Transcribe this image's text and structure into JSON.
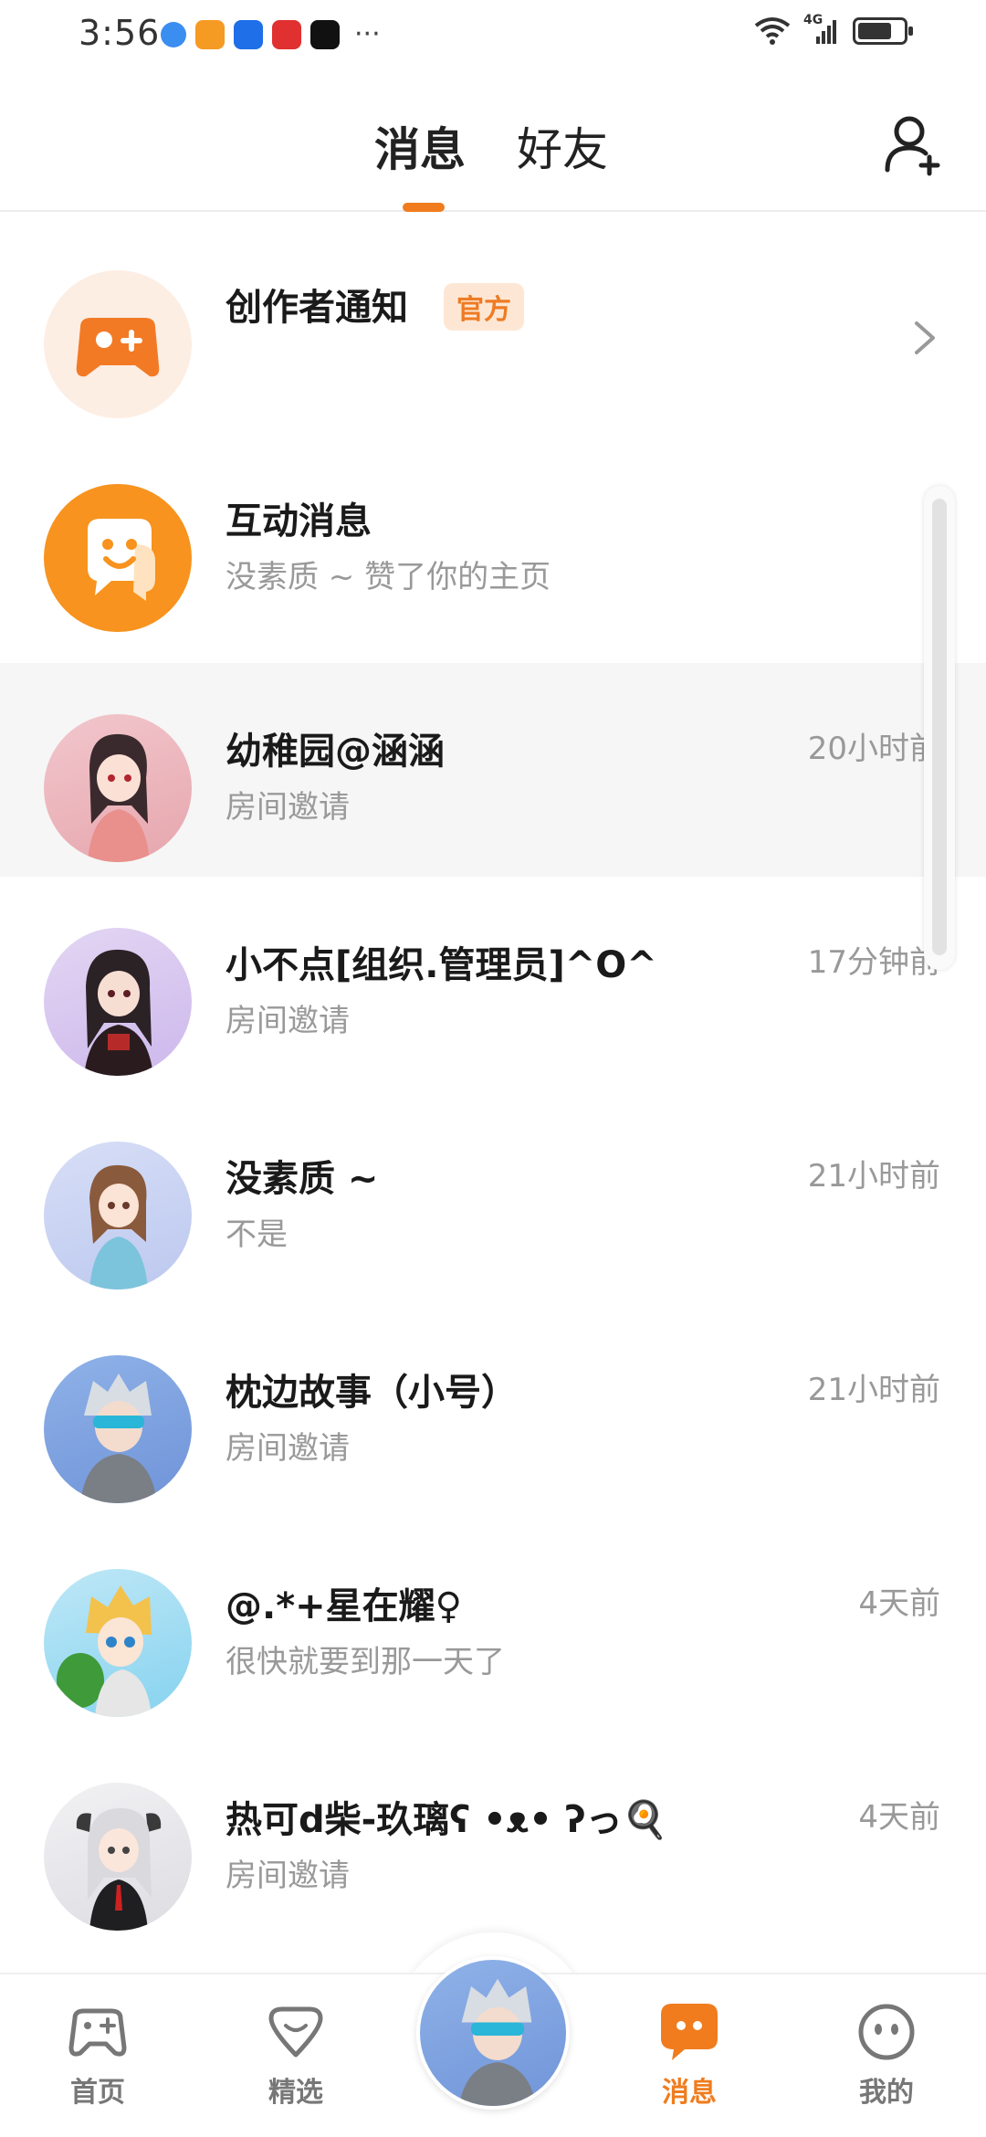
{
  "status_bar": {
    "time": "3:56",
    "more": "···",
    "network": "4G"
  },
  "header": {
    "tabs": [
      {
        "label": "消息",
        "active": true
      },
      {
        "label": "好友",
        "active": false
      }
    ],
    "accent_color": "#f07c1e"
  },
  "list": {
    "rows": [
      {
        "title": "创作者通知",
        "badge": "官方",
        "subtitle": "",
        "time": ""
      },
      {
        "title": "互动消息",
        "subtitle": "没素质 ~ 赞了你的主页",
        "time": ""
      },
      {
        "title": "幼稚园@涵涵",
        "subtitle": "房间邀请",
        "time": "20小时前"
      },
      {
        "title": "小不点[组织.管理员]^O^",
        "subtitle": "房间邀请",
        "time": "17分钟前"
      },
      {
        "title": "没素质 ~",
        "subtitle": "不是",
        "time": "21小时前"
      },
      {
        "title": "枕边故事（小号）",
        "subtitle": "房间邀请",
        "time": "21小时前"
      },
      {
        "title": "@.*+星在耀♀",
        "subtitle": "很快就要到那一天了",
        "time": "4天前"
      },
      {
        "title": "热可d柴-玖璃ʕ •ᴥ• ʔっ🍳",
        "subtitle": "房间邀请",
        "time": "4天前"
      }
    ]
  },
  "bottom_nav": {
    "items": [
      {
        "label": "首页",
        "icon": "gamepad-icon",
        "active": false
      },
      {
        "label": "精选",
        "icon": "heart-diamond-icon",
        "active": false
      },
      {
        "label": "消息",
        "icon": "chat-bubble-icon",
        "active": true
      },
      {
        "label": "我的",
        "icon": "face-icon",
        "active": false
      }
    ]
  }
}
